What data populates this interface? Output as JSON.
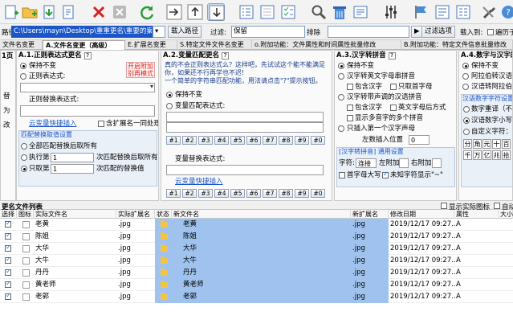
{
  "toolbar": {
    "icons": [
      "add-files-icon",
      "add-folder-icon",
      "import-icon",
      "export-icon",
      "remove-icon",
      "clear-icon",
      "refresh-icon",
      "move-top-icon",
      "move-up-icon",
      "move-down-icon",
      "move-bottom-icon",
      "select-all-icon",
      "select-none-icon",
      "invert-select-icon",
      "find-icon",
      "delete-icon",
      "edit-icon",
      "options-icon",
      "filter-icon",
      "report-icon",
      "compare-icon",
      "tools-icon",
      "help-icon"
    ]
  },
  "pathbar": {
    "path_label": "路径",
    "path_value": "C:\\Users\\mayn\\Desktop\\重重更名\\重要的案例\\",
    "load_path": "载入路径",
    "filter_label": "过滤:",
    "filter_value": "保留",
    "sort_label": "排除",
    "filter_select": "过滤选项",
    "load_to": "载入到:",
    "subfolders": "遍历子"
  },
  "tabs": [
    {
      "label": "文件名变更"
    },
    {
      "label": "A.文件名变更（高级）",
      "active": true
    },
    {
      "label": "E.扩展名变更"
    },
    {
      "label": "S.特定文件文件名变更"
    },
    {
      "label": "o.附加功能：文件属性和时间属性批量修改"
    },
    {
      "label": "B.附加功能：特定文件信息批量修改"
    }
  ],
  "left_stub": {
    "top": "1页",
    "items": [
      "替",
      "为",
      "改"
    ]
  },
  "panel_a1": {
    "title": "A.1.正则表达式更名",
    "keep": "保持不变",
    "regex": "正则表达式:",
    "note": "开启附加\n别再模式",
    "replace": "正则替换表达式:",
    "cloud_help": "云变量快捷插入",
    "ext_together": "含扩展名一同处理",
    "match_section": "匹配替换取值设置",
    "all_match": "全部匹配替换后取所有",
    "exec_row": "执行第",
    "exec_num": "1",
    "exec_text": "次匹配替换后取所有",
    "only_row": "只取第",
    "only_num": "1",
    "only_text": "次匹配的替换值"
  },
  "panel_a2": {
    "title": "A.2.变量匹配更名",
    "intro": "真的不会正则表达式么？这样吧，先试试这个能不能满足你，如果还不行再学也不迟!\n一个简单的字符串匹配功能，用法请点击\"?\"提示按钮。",
    "keep": "保持不变",
    "var_expr": "变量匹配表达式:",
    "nums1": [
      "#1",
      "#2",
      "#3",
      "#4",
      "#5",
      "#6",
      "#7",
      "#8",
      "#9",
      "#0"
    ],
    "replace": "变量替换表达式:",
    "cloud_help": "云变量快捷插入",
    "nums2": [
      "#1",
      "#2",
      "#3",
      "#4",
      "#5",
      "#6",
      "#7",
      "#8",
      "#9",
      "#0"
    ]
  },
  "panel_a3": {
    "title": "A.3.汉字转拼音",
    "keep": "保持不变",
    "py_full": "汉字转英文字母串拼音",
    "tone": "包含汉字",
    "initial": "只取首字母",
    "py_tone": "汉字转带声调的汉语拼音",
    "tone2": "包含汉字",
    "eng_space": "英文字母后方式",
    "multi": "显示多音字的多个拼音",
    "first": "只插入第一个汉字声母",
    "pos_label": "左数插入位置",
    "pos_val": "0",
    "common": "[汉字转拼音] 通用设置",
    "sep": "字符:",
    "sep_val": "连接",
    "left": "左附加",
    "right": "右附加",
    "first_upper": "首字母大写",
    "unknown": "未知字符显示\"~\""
  },
  "panel_a4": {
    "title": "A.4.数字与汉字的",
    "keep": "保持不变",
    "arabic_cn": "阿拉伯转汉语",
    "cn_arabic": "汉语转阿拉伯",
    "setting": "汉语数字字符设置",
    "upper": "数字重译（不含",
    "lower": "汉语数字小写",
    "custom": "自定义字符：",
    "chars": [
      "分",
      "角",
      "元",
      "十",
      "百",
      "千",
      "万",
      "亿",
      "兆",
      "拾"
    ]
  },
  "list": {
    "title": "更名文件列表",
    "show_actual": "显示实际图标",
    "auto": "自动",
    "columns": [
      "选择",
      "图标",
      "实际文件名",
      "实际扩展名",
      "状态",
      "新文件名",
      "新扩展名",
      "修改日期",
      "属性",
      "大小"
    ],
    "rows": [
      {
        "name": "老黄",
        "ext": ".jpg",
        "newname": "老黄",
        "newext": ".jpg",
        "date": "2019/12/17 09:27...",
        "attr": "A"
      },
      {
        "name": "陈姐",
        "ext": ".jpg",
        "newname": "陈姐",
        "newext": ".jpg",
        "date": "2019/12/17 09:27...",
        "attr": "A"
      },
      {
        "name": "大华",
        "ext": ".jpg",
        "newname": "大华",
        "newext": ".jpg",
        "date": "2019/12/17 09:27...",
        "attr": "A"
      },
      {
        "name": "大牛",
        "ext": ".jpg",
        "newname": "大牛",
        "newext": ".jpg",
        "date": "2019/12/17 09:27...",
        "attr": "A"
      },
      {
        "name": "丹丹",
        "ext": ".jpg",
        "newname": "丹丹",
        "newext": ".jpg",
        "date": "2019/12/17 09:27...",
        "attr": "A"
      },
      {
        "name": "黄老师",
        "ext": ".jpg",
        "newname": "黄老师",
        "newext": ".jpg",
        "date": "2019/12/17 09:27...",
        "attr": "A"
      },
      {
        "name": "老郭",
        "ext": ".jpg",
        "newname": "老郭",
        "newext": ".jpg",
        "date": "2019/12/17 09:27...",
        "attr": "A"
      }
    ]
  },
  "colors": {
    "accent": "#1a56c8",
    "selection": "#9fc3ee",
    "note_red": "#e0201c"
  }
}
